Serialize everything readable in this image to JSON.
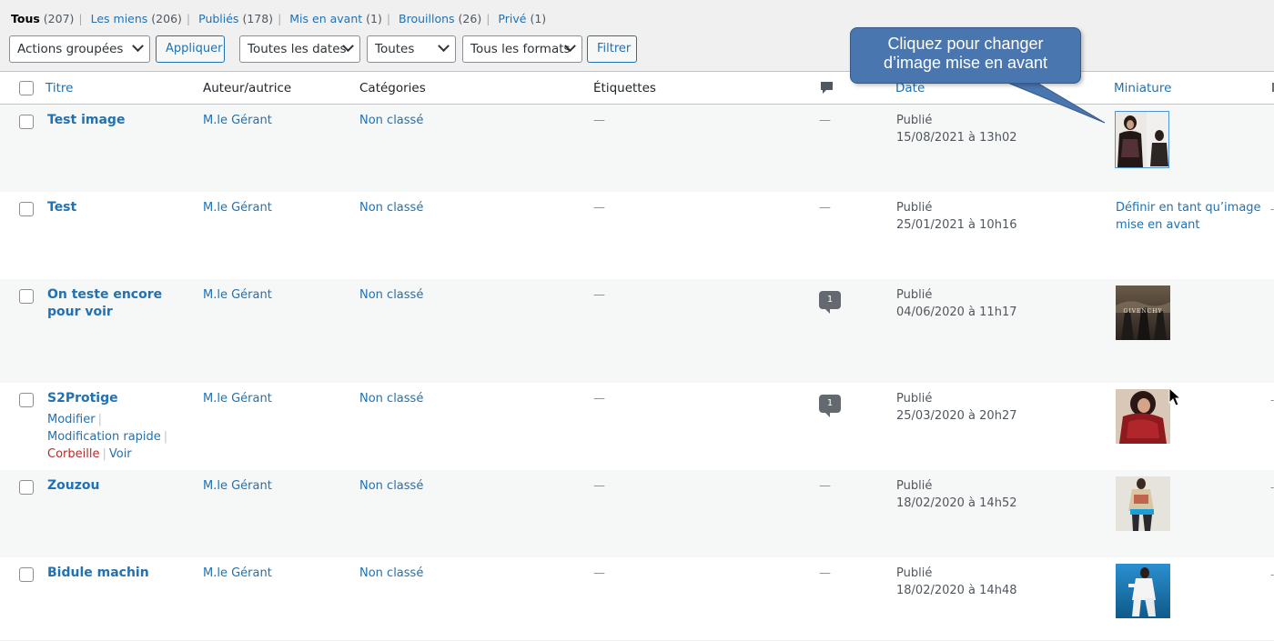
{
  "filters": [
    {
      "label": "Tous",
      "count": "(207)",
      "current": true
    },
    {
      "label": "Les miens",
      "count": "(206)"
    },
    {
      "label": "Publiés",
      "count": "(178)"
    },
    {
      "label": "Mis en avant",
      "count": "(1)"
    },
    {
      "label": "Brouillons",
      "count": "(26)"
    },
    {
      "label": "Privé",
      "count": "(1)"
    }
  ],
  "toolbar": {
    "bulk_actions": "Actions groupées",
    "apply": "Appliquer",
    "dates": "Toutes les dates",
    "categories": "Toutes",
    "formats": "Tous les formats",
    "filter": "Filtrer"
  },
  "columns": {
    "title": "Titre",
    "author": "Auteur/autrice",
    "categories": "Catégories",
    "tags": "Étiquettes",
    "date": "Date",
    "thumbnail": "Miniature"
  },
  "callout": {
    "line1": "Cliquez pour changer",
    "line2": "d’image mise en avant"
  },
  "rows": [
    {
      "title": "Test image",
      "author": "M.le Gérant",
      "category": "Non classé",
      "tags": "—",
      "comments": "—",
      "status": "Publié",
      "date": "15/08/2021 à 13h02"
    },
    {
      "title": "Test",
      "author": "M.le Gérant",
      "category": "Non classé",
      "tags": "—",
      "comments": "—",
      "status": "Publié",
      "date": "25/01/2021 à 10h16",
      "set_featured": "Définir en tant qu’image mise en avant"
    },
    {
      "title": "On teste encore pour voir",
      "author": "M.le Gérant",
      "category": "Non classé",
      "tags": "—",
      "comments": "1",
      "status": "Publié",
      "date": "04/06/2020 à 11h17",
      "thumb_text": "GIVENCHY"
    },
    {
      "title": "S2Protige",
      "author": "M.le Gérant",
      "category": "Non classé",
      "tags": "—",
      "comments": "1",
      "status": "Publié",
      "date": "25/03/2020 à 20h27",
      "actions": {
        "edit": "Modifier",
        "quick_edit": "Modification rapide",
        "trash": "Corbeille",
        "view": "Voir"
      }
    },
    {
      "title": "Zouzou",
      "author": "M.le Gérant",
      "category": "Non classé",
      "tags": "—",
      "comments": "—",
      "status": "Publié",
      "date": "18/02/2020 à 14h52"
    },
    {
      "title": "Bidule machin",
      "author": "M.le Gérant",
      "category": "Non classé",
      "tags": "—",
      "comments": "—",
      "status": "Publié",
      "date": "18/02/2020 à 14h48"
    }
  ]
}
